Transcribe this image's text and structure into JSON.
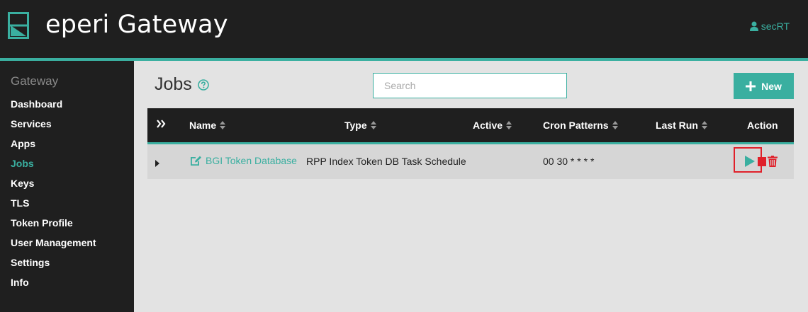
{
  "header": {
    "title": "eperi Gateway",
    "user": "secRT"
  },
  "sidebar": {
    "section_title": "Gateway",
    "items": [
      {
        "label": "Dashboard"
      },
      {
        "label": "Services"
      },
      {
        "label": "Apps"
      },
      {
        "label": "Jobs",
        "active": true
      },
      {
        "label": "Keys"
      },
      {
        "label": "TLS"
      },
      {
        "label": "Token Profile"
      },
      {
        "label": "User Management"
      },
      {
        "label": "Settings"
      },
      {
        "label": "Info"
      }
    ]
  },
  "main": {
    "title": "Jobs",
    "search_placeholder": "Search",
    "new_label": "New"
  },
  "table": {
    "columns": {
      "name": "Name",
      "type": "Type",
      "active": "Active",
      "cron": "Cron Patterns",
      "last_run": "Last Run",
      "action": "Action"
    },
    "rows": [
      {
        "name": "BGI Token Database",
        "type": "RPP Index Token DB Task Schedule",
        "active": "",
        "cron": "00 30 * * * *",
        "last_run": ""
      }
    ]
  },
  "colors": {
    "accent": "#3aafa0",
    "header_bg": "#1f1f1f",
    "danger": "#e0202a"
  }
}
